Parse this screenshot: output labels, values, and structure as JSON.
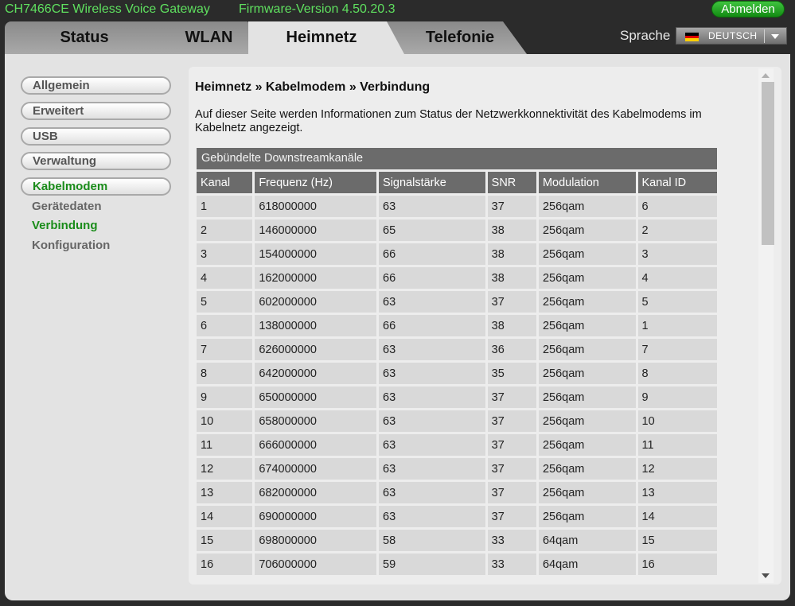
{
  "header": {
    "model": "CH7466CE  Wireless Voice Gateway",
    "firmware": "Firmware-Version  4.50.20.3",
    "logout_label": "Abmelden"
  },
  "tabs": [
    {
      "label": "Status",
      "active": false
    },
    {
      "label": "WLAN",
      "active": false
    },
    {
      "label": "Heimnetz",
      "active": true
    },
    {
      "label": "Telefonie",
      "active": false
    }
  ],
  "language": {
    "label": "Sprache",
    "selected": "DEUTSCH",
    "flag_colors": [
      "#000000",
      "#dd0000",
      "#ffce00"
    ]
  },
  "sidebar": {
    "items": [
      {
        "label": "Allgemein",
        "active": false
      },
      {
        "label": "Erweitert",
        "active": false
      },
      {
        "label": "USB",
        "active": false
      },
      {
        "label": "Verwaltung",
        "active": false
      },
      {
        "label": "Kabelmodem",
        "active": true
      }
    ],
    "subitems": [
      {
        "label": "Gerätedaten",
        "active": false
      },
      {
        "label": "Verbindung",
        "active": true
      },
      {
        "label": "Konfiguration",
        "active": false
      }
    ]
  },
  "content": {
    "breadcrumb": "Heimnetz » Kabelmodem » Verbindung",
    "description": "Auf dieser Seite werden Informationen zum Status der Netzwerkkonnektivität des Kabelmodems im Kabelnetz angezeigt.",
    "table_title": "Gebündelte Downstreamkanäle",
    "columns": [
      "Kanal",
      "Frequenz (Hz)",
      "Signalstärke",
      "SNR",
      "Modulation",
      "Kanal ID"
    ],
    "rows": [
      [
        "1",
        "618000000",
        "63",
        "37",
        "256qam",
        "6"
      ],
      [
        "2",
        "146000000",
        "65",
        "38",
        "256qam",
        "2"
      ],
      [
        "3",
        "154000000",
        "66",
        "38",
        "256qam",
        "3"
      ],
      [
        "4",
        "162000000",
        "66",
        "38",
        "256qam",
        "4"
      ],
      [
        "5",
        "602000000",
        "63",
        "37",
        "256qam",
        "5"
      ],
      [
        "6",
        "138000000",
        "66",
        "38",
        "256qam",
        "1"
      ],
      [
        "7",
        "626000000",
        "63",
        "36",
        "256qam",
        "7"
      ],
      [
        "8",
        "642000000",
        "63",
        "35",
        "256qam",
        "8"
      ],
      [
        "9",
        "650000000",
        "63",
        "37",
        "256qam",
        "9"
      ],
      [
        "10",
        "658000000",
        "63",
        "37",
        "256qam",
        "10"
      ],
      [
        "11",
        "666000000",
        "63",
        "37",
        "256qam",
        "11"
      ],
      [
        "12",
        "674000000",
        "63",
        "37",
        "256qam",
        "12"
      ],
      [
        "13",
        "682000000",
        "63",
        "37",
        "256qam",
        "13"
      ],
      [
        "14",
        "690000000",
        "63",
        "37",
        "256qam",
        "14"
      ],
      [
        "15",
        "698000000",
        "58",
        "33",
        "64qam",
        "15"
      ],
      [
        "16",
        "706000000",
        "59",
        "33",
        "64qam",
        "16"
      ]
    ]
  },
  "colors": {
    "accent_green": "#1a8c1a",
    "header_green": "#5fe05f",
    "table_header": "#6b6b6b",
    "table_cell": "#d9d9d9"
  }
}
